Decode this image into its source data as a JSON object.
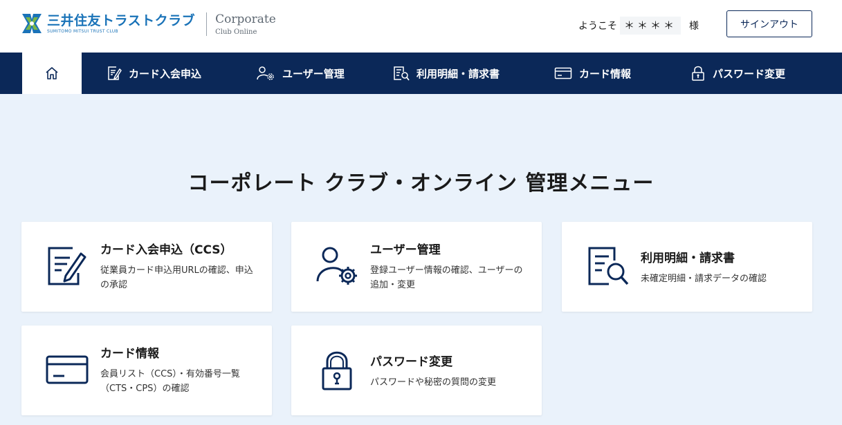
{
  "header": {
    "logo_jp": "三井住友トラストクラブ",
    "logo_en": "SUMITOMO MITSUI TRUST CLUB",
    "corporate_title": "Corporate",
    "corporate_sub": "Club Online",
    "welcome_prefix": "ようこそ",
    "user_name": "＊＊＊＊",
    "welcome_suffix": "様",
    "signout_label": "サインアウト"
  },
  "nav": {
    "home_icon": "home-icon",
    "items": [
      {
        "label": "カード入会申込",
        "icon": "application-icon"
      },
      {
        "label": "ユーザー管理",
        "icon": "user-gear-icon"
      },
      {
        "label": "利用明細・請求書",
        "icon": "statement-search-icon"
      },
      {
        "label": "カード情報",
        "icon": "card-icon"
      },
      {
        "label": "パスワード変更",
        "icon": "lock-icon"
      }
    ]
  },
  "main": {
    "title": "コーポレート クラブ・オンライン 管理メニュー",
    "cards": [
      {
        "title": "カード入会申込（CCS）",
        "desc": "従業員カード申込用URLの確認、申込の承認",
        "icon": "application-icon"
      },
      {
        "title": "ユーザー管理",
        "desc": "登録ユーザー情報の確認、ユーザーの追加・変更",
        "icon": "user-gear-icon"
      },
      {
        "title": "利用明細・請求書",
        "desc": "未確定明細・請求データの確認",
        "icon": "statement-search-icon"
      },
      {
        "title": "カード情報",
        "desc": "会員リスト（CCS）・有効番号一覧（CTS・CPS）の確認",
        "icon": "card-icon"
      },
      {
        "title": "パスワード変更",
        "desc": "パスワードや秘密の質問の変更",
        "icon": "lock-icon"
      }
    ]
  },
  "colors": {
    "navy": "#0b2858",
    "background": "#eaf2fb",
    "logo_blue": "#1a73b8",
    "logo_green": "#7ab648"
  }
}
